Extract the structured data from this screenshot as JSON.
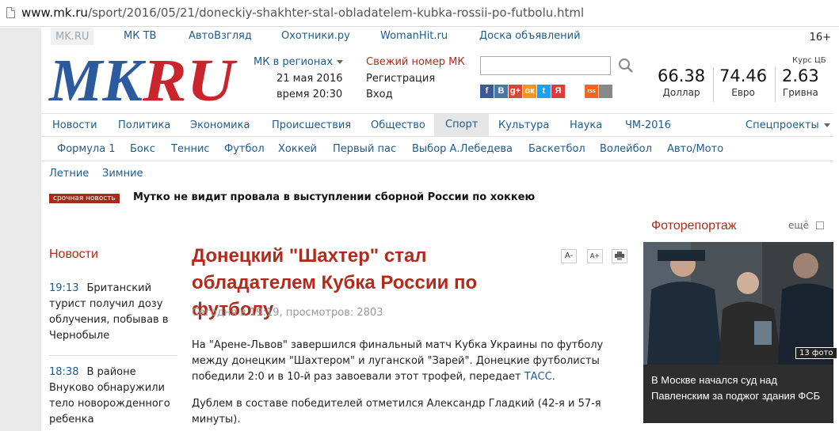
{
  "browser": {
    "url_host": "www.mk.ru",
    "url_path": "/sport/2016/05/21/doneckiy-shakhter-stal-obladatelem-kubka-rossii-po-futbolu.html"
  },
  "toplinks": [
    "MK.RU",
    "МК ТВ",
    "АвтоВзгляд",
    "Охотники.ру",
    "WomanHit.ru",
    "Доска объявлений"
  ],
  "age_rating": "16+",
  "header": {
    "logo_text": "MKRU",
    "regions": "МК в регионах",
    "date": "21 мая 2016",
    "time": "время 20:30",
    "fresh_issue": "Свежий номер МК",
    "register": "Регистрация",
    "login": "Вход",
    "search": {
      "value": "",
      "placeholder": ""
    }
  },
  "socials": [
    {
      "letter": "f",
      "color": "#3b5998"
    },
    {
      "letter": "B",
      "color": "#4a76a8"
    },
    {
      "letter": "g+",
      "color": "#d34836"
    },
    {
      "letter": "ок",
      "color": "#f7931e"
    },
    {
      "letter": "t",
      "color": "#1da1f2"
    },
    {
      "letter": "Я",
      "color": "#e03a3a"
    },
    {
      "letter": "rss",
      "color": "#f26522"
    },
    {
      "letter": "",
      "color": "#888888"
    }
  ],
  "currency": {
    "header": "Курс ЦБ",
    "items": [
      {
        "value": "66.38",
        "label": "Доллар"
      },
      {
        "value": "74.46",
        "label": "Евро"
      },
      {
        "value": "2.63",
        "label": "Гривна"
      }
    ]
  },
  "nav1": [
    "Новости",
    "Политика",
    "Экономика",
    "Происшествия",
    "Общество",
    "Спорт",
    "Культура",
    "Наука",
    "ЧМ-2016"
  ],
  "nav1_special": "Спецпроекты",
  "nav2": [
    "Формула 1",
    "Бокс",
    "Теннис",
    "Футбол",
    "Хоккей",
    "Первый пас",
    "Выбор А.Лебедева",
    "Баскетбол",
    "Волейбол",
    "Авто/Мото"
  ],
  "nav3": [
    "Летние",
    "Зимние"
  ],
  "breaking": {
    "tag": "срочная новость",
    "text": "Мутко не видит провала в выступлении сборной России по хоккею"
  },
  "news": {
    "heading": "Новости",
    "items": [
      {
        "time": "19:13",
        "text": "Британский турист получил дозу облучения, побывав в Чернобыле"
      },
      {
        "time": "18:38",
        "text": "В районе Внуково обнаружили тело новорожденного ребенка"
      }
    ]
  },
  "article": {
    "title": "Донецкий \"Шахтер\" стал обладателем Кубка России по футболу",
    "meta": "Сегодня в 19:19, просмотров: 2803",
    "p1": "На \"Арене-Львов\" завершился финальный матч Кубка Украины по футболу между донецким \"Шахтером\" и луганской \"Зарей\". Донецкие футболисты победили 2:0 и в 10-й раз завоевали этот трофей, передает ",
    "p1_link": "ТАСС",
    "p1_end": ".",
    "p2": "Дублем в составе победителей отметился Александр Гладкий (42-я и 57-я минуты).",
    "tools": [
      "A-",
      "A+"
    ]
  },
  "photo": {
    "heading": "Фоторепортаж",
    "more": "ещё",
    "count": "13 фото",
    "caption": "В Москве начался суд над Павленским за поджог здания ФСБ"
  },
  "colors": {
    "brand_red": "#b12a1b",
    "link_blue": "#1d5c8f",
    "logo_blue": "#2b5a9e",
    "logo_red": "#c9252c"
  }
}
